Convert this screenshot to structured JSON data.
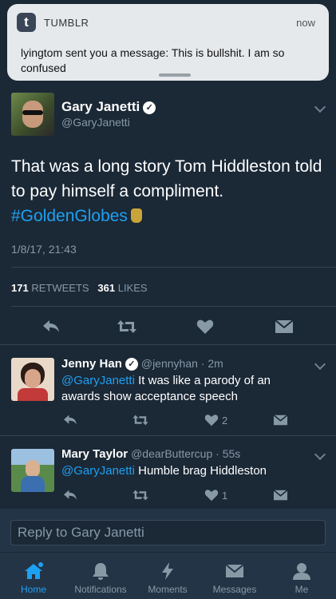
{
  "notification": {
    "app_name": "TUMBLR",
    "time": "now",
    "message": "lyingtom sent you a message: This is bullshit. I am so confused"
  },
  "main_tweet": {
    "name": "Gary Janetti",
    "handle": "@GaryJanetti",
    "text_plain": "That was a long story Tom Hiddleston told to pay himself a compliment.",
    "hashtag": "#GoldenGlobes",
    "date": "1/8/17, 21:43",
    "retweets_count": "171",
    "retweets_label": "RETWEETS",
    "likes_count": "361",
    "likes_label": "LIKES"
  },
  "replies": [
    {
      "name": "Jenny Han",
      "handle": "@jennyhan · 2m",
      "mention": "@GaryJanetti",
      "text": " It was like a parody of an awards show acceptance speech",
      "likes": "2"
    },
    {
      "name": "Mary Taylor",
      "handle": "@dearButtercup · 55s",
      "mention": "@GaryJanetti",
      "text": " Humble brag Hiddleston",
      "likes": "1"
    }
  ],
  "composer": {
    "placeholder": "Reply to Gary Janetti"
  },
  "tabs": [
    {
      "label": "Home",
      "icon": "home-icon",
      "active": true
    },
    {
      "label": "Notifications",
      "icon": "bell-icon",
      "active": false
    },
    {
      "label": "Moments",
      "icon": "lightning-icon",
      "active": false
    },
    {
      "label": "Messages",
      "icon": "envelope-icon",
      "active": false
    },
    {
      "label": "Me",
      "icon": "person-icon",
      "active": false
    }
  ],
  "colors": {
    "background": "#1b2836",
    "accent": "#1da1f2",
    "muted": "#8899a6"
  }
}
